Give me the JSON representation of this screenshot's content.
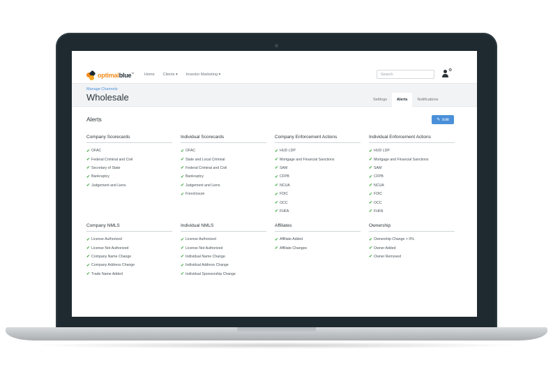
{
  "app": {
    "logo_brand_orange": "optimal",
    "logo_brand_dark": "blue",
    "logo_tm": "™"
  },
  "nav": {
    "home": "Home",
    "clients": "Clients ▾",
    "investor_marketing": "Investor Marketing ▾",
    "search_placeholder": "Search"
  },
  "header": {
    "breadcrumb": "Manage Channels",
    "title": "Wholesale",
    "tabs": [
      "Settings",
      "Alerts",
      "Notifications"
    ],
    "active_tab": "Alerts"
  },
  "alerts": {
    "title": "Alerts",
    "edit_label": "Edit"
  },
  "colors": {
    "accent": "#4a90d9",
    "check": "#4caf50",
    "brand_orange": "#f28a1a"
  },
  "sections": [
    {
      "heading": "Company Scorecards",
      "items": [
        "OFAC",
        "Federal Criminal and Civil",
        "Secretary of State",
        "Bankruptcy",
        "Judgement and Liens"
      ]
    },
    {
      "heading": "Individual Scorecards",
      "items": [
        "OFAC",
        "State and Local Criminal",
        "Federal Criminal and Civil",
        "Bankruptcy",
        "Judgement and Liens",
        "Foreclosure"
      ]
    },
    {
      "heading": "Company Enforcement Actions",
      "items": [
        "HUD LDP",
        "Mortgage and Financial Sanctions",
        "SAM",
        "CFPB",
        "NCUA",
        "FDIC",
        "OCC",
        "FHFA"
      ]
    },
    {
      "heading": "Individual Enforcement Actions",
      "items": [
        "HUD LDP",
        "Mortgage and Financial Sanctions",
        "SAM",
        "CFPB",
        "NCUA",
        "FDIC",
        "OCC",
        "FHFA"
      ]
    },
    {
      "heading": "Company NMLS",
      "items": [
        "License Authorized",
        "License Not Authorized",
        "Company Name Change",
        "Company Address Change",
        "Trade Name Added"
      ]
    },
    {
      "heading": "Individual NMLS",
      "items": [
        "License Authorized",
        "License Not Authorized",
        "Individual Name Change",
        "Individual Address Change",
        "Individual Sponsorship Change"
      ]
    },
    {
      "heading": "Affiliates",
      "items": [
        "Affiliate Added",
        "Affiliate Changes"
      ]
    },
    {
      "heading": "Ownership",
      "items": [
        "Ownership Change > 0%",
        "Owner Added",
        "Owner Removed"
      ]
    }
  ]
}
